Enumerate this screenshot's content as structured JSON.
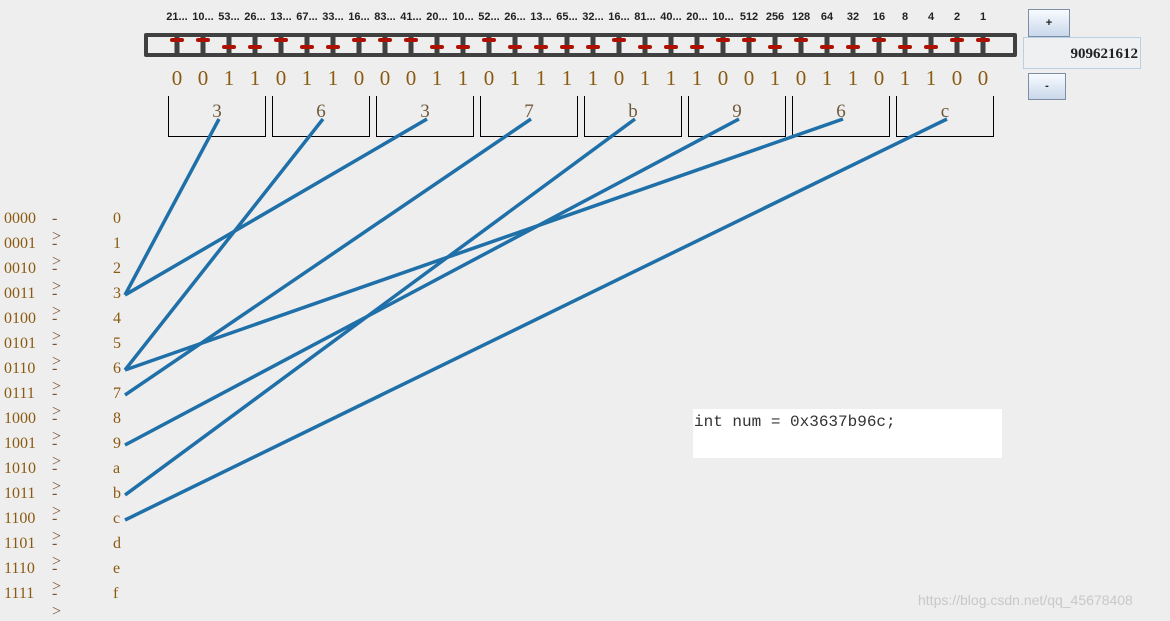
{
  "weights": [
    "21...",
    "10...",
    "53...",
    "26...",
    "13...",
    "67...",
    "33...",
    "16...",
    "83...",
    "41...",
    "20...",
    "10...",
    "52...",
    "26...",
    "13...",
    "65...",
    "32...",
    "16...",
    "81...",
    "40...",
    "20...",
    "10...",
    "512",
    "256",
    "128",
    "64",
    "32",
    "16",
    "8",
    "4",
    "2",
    "1"
  ],
  "bits": [
    0,
    0,
    1,
    1,
    0,
    1,
    1,
    0,
    0,
    0,
    1,
    1,
    0,
    1,
    1,
    1,
    1,
    0,
    1,
    1,
    1,
    0,
    0,
    1,
    0,
    1,
    1,
    0,
    1,
    1,
    0,
    0
  ],
  "nibbles": [
    "3",
    "6",
    "3",
    "7",
    "b",
    "9",
    "6",
    "c"
  ],
  "plus_label": "+",
  "minus_label": "-",
  "number_value": "909621612",
  "table": [
    {
      "bin": "0000",
      "arrow": "->",
      "hex": "0"
    },
    {
      "bin": "0001",
      "arrow": "->",
      "hex": "1"
    },
    {
      "bin": "0010",
      "arrow": "->",
      "hex": "2"
    },
    {
      "bin": "0011",
      "arrow": "->",
      "hex": "3"
    },
    {
      "bin": "0100",
      "arrow": "->",
      "hex": "4"
    },
    {
      "bin": "0101",
      "arrow": "->",
      "hex": "5"
    },
    {
      "bin": "0110",
      "arrow": "->",
      "hex": "6"
    },
    {
      "bin": "0111",
      "arrow": "->",
      "hex": "7"
    },
    {
      "bin": "1000",
      "arrow": "->",
      "hex": "8"
    },
    {
      "bin": "1001",
      "arrow": "->",
      "hex": "9"
    },
    {
      "bin": "1010",
      "arrow": "->",
      "hex": "a"
    },
    {
      "bin": "1011",
      "arrow": "->",
      "hex": "b"
    },
    {
      "bin": "1100",
      "arrow": "->",
      "hex": "c"
    },
    {
      "bin": "1101",
      "arrow": "->",
      "hex": "d"
    },
    {
      "bin": "1110",
      "arrow": "->",
      "hex": "e"
    },
    {
      "bin": "1111",
      "arrow": "->",
      "hex": "f"
    }
  ],
  "code_text": "int num = 0x3637b96c;",
  "watermark": "https://blog.csdn.net/qq_45678408",
  "colors": {
    "bead": "#b01000",
    "frame": "#404040",
    "link_line": "#1f6fa8"
  }
}
